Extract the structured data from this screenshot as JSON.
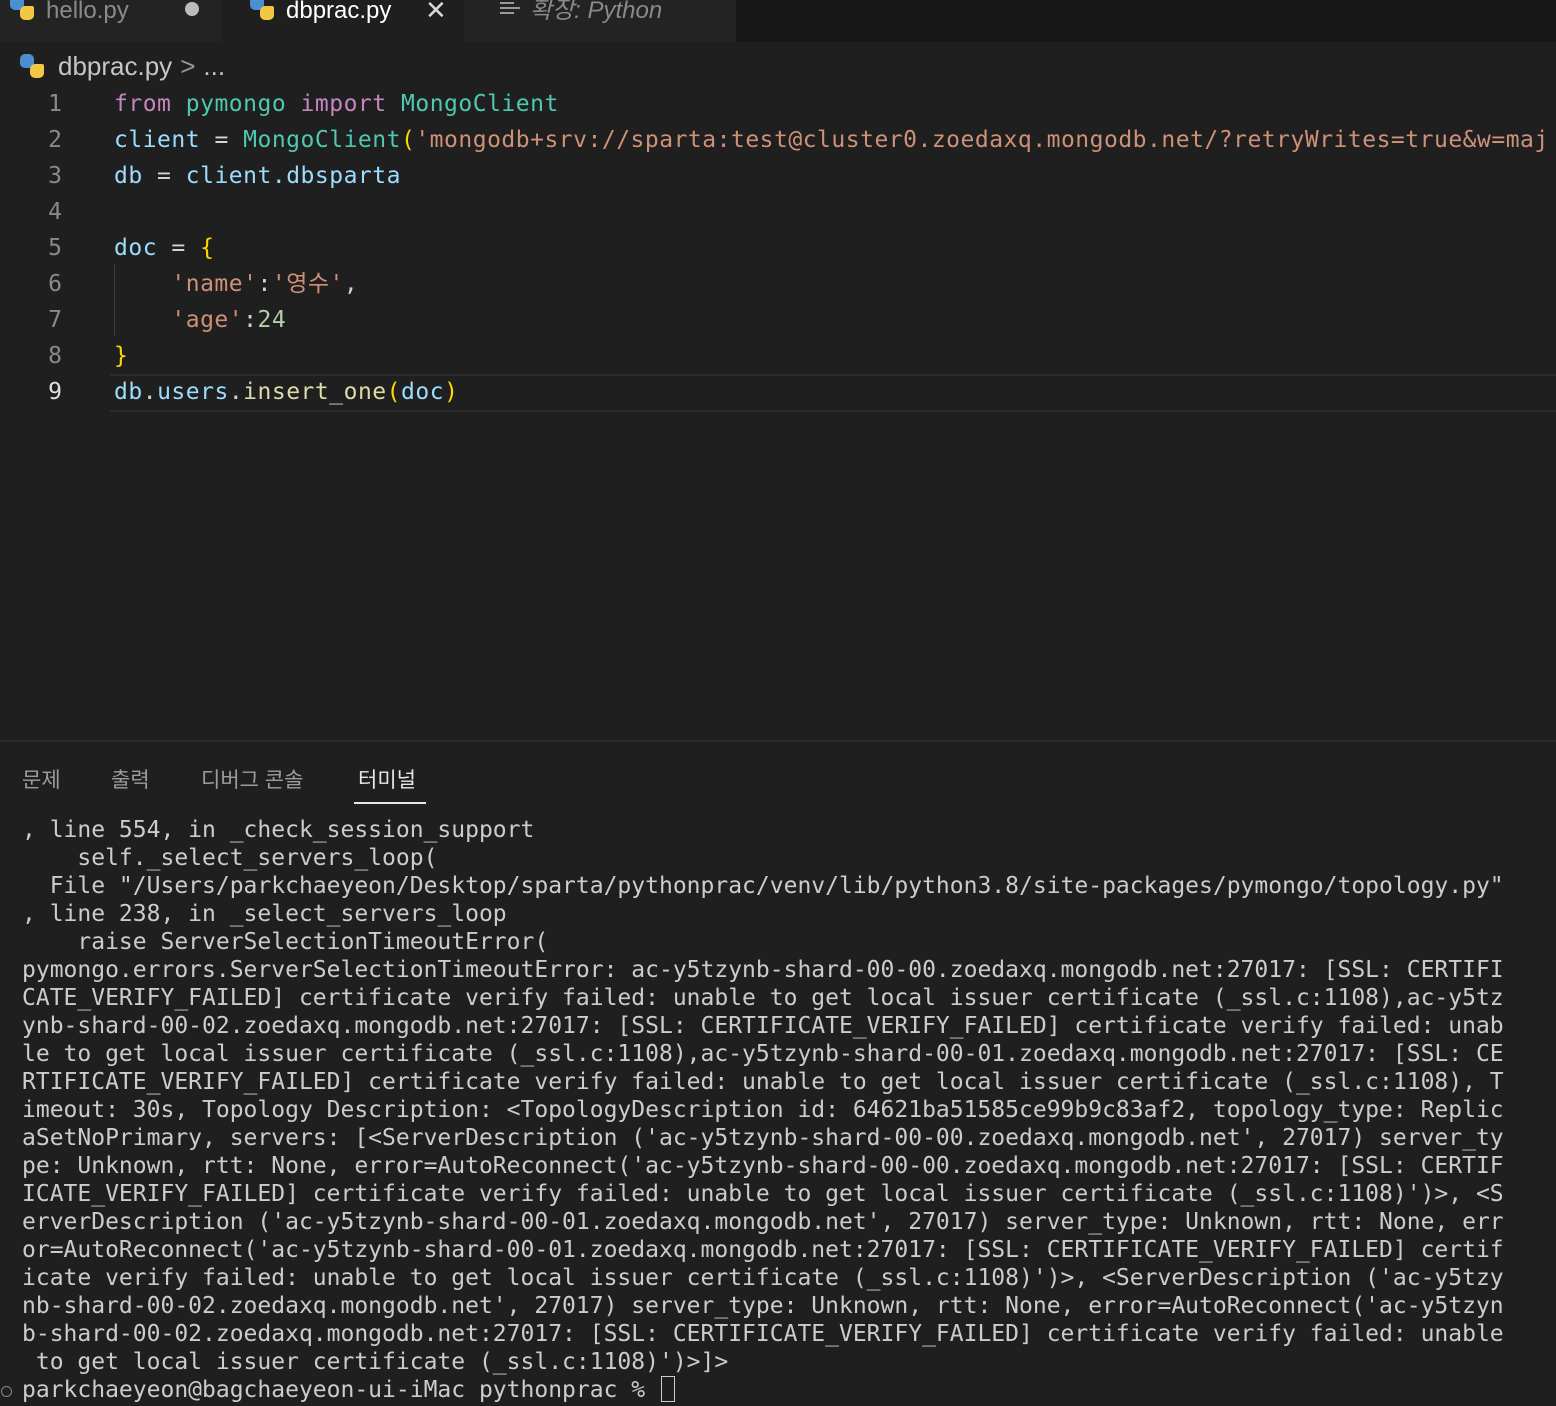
{
  "tabs": [
    {
      "label": "hello.py",
      "modified": true
    },
    {
      "label": "dbprac.py",
      "active": true
    },
    {
      "label": "확장: Python",
      "preview": true
    }
  ],
  "breadcrumb": {
    "file": "dbprac.py",
    "separator": ">",
    "rest": "..."
  },
  "editor": {
    "line_numbers": [
      "1",
      "2",
      "3",
      "4",
      "5",
      "6",
      "7",
      "8",
      "9"
    ],
    "active_line": "9"
  },
  "code": {
    "l1": {
      "from": "from",
      "mod": "pymongo",
      "import": "import",
      "cls": "MongoClient"
    },
    "l2": {
      "var": "client",
      "eq": " = ",
      "fn": "MongoClient",
      "open": "(",
      "str": "'mongodb+srv://sparta:test@cluster0.zoedaxq.mongodb.net/?retryWrites=true&w=maj"
    },
    "l3": {
      "var": "db",
      "eq": " = ",
      "obj": "client",
      "attr": ".dbsparta"
    },
    "l5": {
      "var": "doc",
      "eq": " = ",
      "brace": "{"
    },
    "l6": {
      "key": "'name'",
      "colon": ":",
      "val": "'영수'",
      "comma": ","
    },
    "l7": {
      "key": "'age'",
      "colon": ":",
      "val": "24"
    },
    "l8": {
      "brace": "}"
    },
    "l9": {
      "obj": "db",
      "dot1": ".",
      "attr": "users",
      "dot2": ".",
      "fn": "insert_one",
      "open": "(",
      "arg": "doc",
      "close": ")"
    }
  },
  "panel": {
    "tabs": [
      "문제",
      "출력",
      "디버그 콘솔",
      "터미널"
    ],
    "active_tab": "터미널"
  },
  "terminal": {
    "lines": [
      ", line 554, in _check_session_support",
      "    self._select_servers_loop(",
      "  File \"/Users/parkchaeyeon/Desktop/sparta/pythonprac/venv/lib/python3.8/site-packages/pymongo/topology.py\"",
      ", line 238, in _select_servers_loop",
      "    raise ServerSelectionTimeoutError(",
      "pymongo.errors.ServerSelectionTimeoutError: ac-y5tzynb-shard-00-00.zoedaxq.mongodb.net:27017: [SSL: CERTIFI",
      "CATE_VERIFY_FAILED] certificate verify failed: unable to get local issuer certificate (_ssl.c:1108),ac-y5tz",
      "ynb-shard-00-02.zoedaxq.mongodb.net:27017: [SSL: CERTIFICATE_VERIFY_FAILED] certificate verify failed: unab",
      "le to get local issuer certificate (_ssl.c:1108),ac-y5tzynb-shard-00-01.zoedaxq.mongodb.net:27017: [SSL: CE",
      "RTIFICATE_VERIFY_FAILED] certificate verify failed: unable to get local issuer certificate (_ssl.c:1108), T",
      "imeout: 30s, Topology Description: <TopologyDescription id: 64621ba51585ce99b9c83af2, topology_type: Replic",
      "aSetNoPrimary, servers: [<ServerDescription ('ac-y5tzynb-shard-00-00.zoedaxq.mongodb.net', 27017) server_ty",
      "pe: Unknown, rtt: None, error=AutoReconnect('ac-y5tzynb-shard-00-00.zoedaxq.mongodb.net:27017: [SSL: CERTIF",
      "ICATE_VERIFY_FAILED] certificate verify failed: unable to get local issuer certificate (_ssl.c:1108)')>, <S",
      "erverDescription ('ac-y5tzynb-shard-00-01.zoedaxq.mongodb.net', 27017) server_type: Unknown, rtt: None, err",
      "or=AutoReconnect('ac-y5tzynb-shard-00-01.zoedaxq.mongodb.net:27017: [SSL: CERTIFICATE_VERIFY_FAILED] certif",
      "icate verify failed: unable to get local issuer certificate (_ssl.c:1108)')>, <ServerDescription ('ac-y5tzy",
      "nb-shard-00-02.zoedaxq.mongodb.net', 27017) server_type: Unknown, rtt: None, error=AutoReconnect('ac-y5tzyn",
      "b-shard-00-02.zoedaxq.mongodb.net:27017: [SSL: CERTIFICATE_VERIFY_FAILED] certificate verify failed: unable",
      " to get local issuer certificate (_ssl.c:1108)')>]>"
    ],
    "prompt": "parkchaeyeon@bagchaeyeon-ui-iMac pythonprac % "
  }
}
